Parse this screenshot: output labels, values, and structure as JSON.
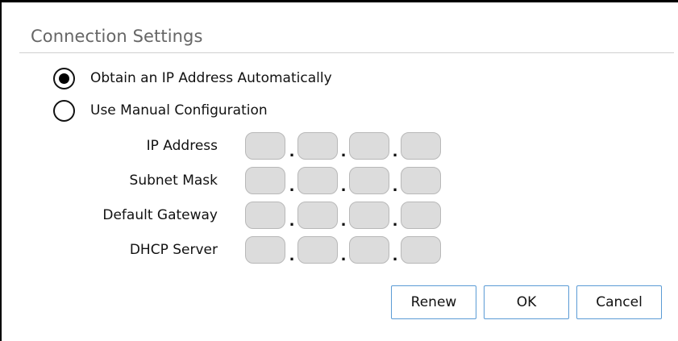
{
  "dialog": {
    "title": "Connection Settings"
  },
  "options": {
    "auto_label": "Obtain an IP Address Automatically",
    "auto_selected": true,
    "manual_label": "Use Manual Configuration",
    "manual_selected": false
  },
  "fields": {
    "ip_address": {
      "label": "IP Address",
      "octets": [
        "",
        "",
        "",
        ""
      ]
    },
    "subnet_mask": {
      "label": "Subnet Mask",
      "octets": [
        "",
        "",
        "",
        ""
      ]
    },
    "default_gateway": {
      "label": "Default Gateway",
      "octets": [
        "",
        "",
        "",
        ""
      ]
    },
    "dhcp_server": {
      "label": "DHCP Server",
      "octets": [
        "",
        "",
        "",
        ""
      ]
    },
    "separator": "."
  },
  "buttons": {
    "renew": "Renew",
    "ok": "OK",
    "cancel": "Cancel"
  },
  "colors": {
    "button_border": "#5b9bd5",
    "octet_fill": "#dcdcdc",
    "title_text": "#666666"
  }
}
